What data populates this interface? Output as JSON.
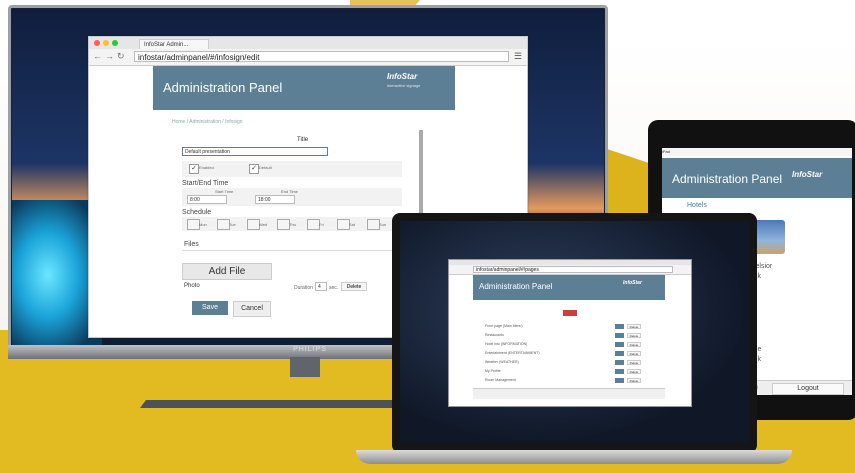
{
  "tv": {
    "brand": "PHILIPS",
    "browser": {
      "tab_title": "InfoStar Admin...",
      "url": "infostar/adminpanel/#/infosign/edit",
      "header": {
        "title": "Administration Panel",
        "logo": "InfoStar",
        "logo_sub": "interactive signage"
      },
      "breadcrumb": "Home / Administration / Infosign",
      "form": {
        "title_label": "Title",
        "title_value": "Default presentation",
        "enabled_label": "Enabled",
        "default_label": "Default",
        "start_end_label": "Start/End Time",
        "start_time_label": "Start Time",
        "end_time_label": "End Time",
        "start_time_value": "8:00",
        "end_time_value": "18:00",
        "schedule_label": "Schedule",
        "days": [
          "Mon",
          "Tue",
          "Wed",
          "Thu",
          "Fri",
          "Sat",
          "Sun"
        ],
        "files_label": "Files",
        "add_file_label": "Add File",
        "photo_label": "Photo",
        "duration_label": "Duration",
        "duration_value": "4",
        "duration_unit": "sec.",
        "delete_label": "Delete",
        "save_label": "Save",
        "cancel_label": "Cancel"
      }
    }
  },
  "tablet": {
    "status": "iPad",
    "title": "Administration Panel",
    "logo": "InfoStar",
    "link": "Hotels",
    "text1": "celsior",
    "text2": "nik",
    "text3": "jue",
    "text4": "nik",
    "footer_left": "mn",
    "logout_label": "Logout"
  },
  "laptop": {
    "url": "infostar/adminpanel/#/pages",
    "title": "Administration Panel",
    "logo": "InfoStar",
    "rows": [
      "Front page (Main Menu)",
      "Restaurants",
      "Hotel info (INFORMATION)",
      "Entertainment (ENTERTAINMENT)",
      "Weather (WEATHER)",
      "My Profile",
      "Room Management"
    ],
    "delete_label": "Delete"
  }
}
